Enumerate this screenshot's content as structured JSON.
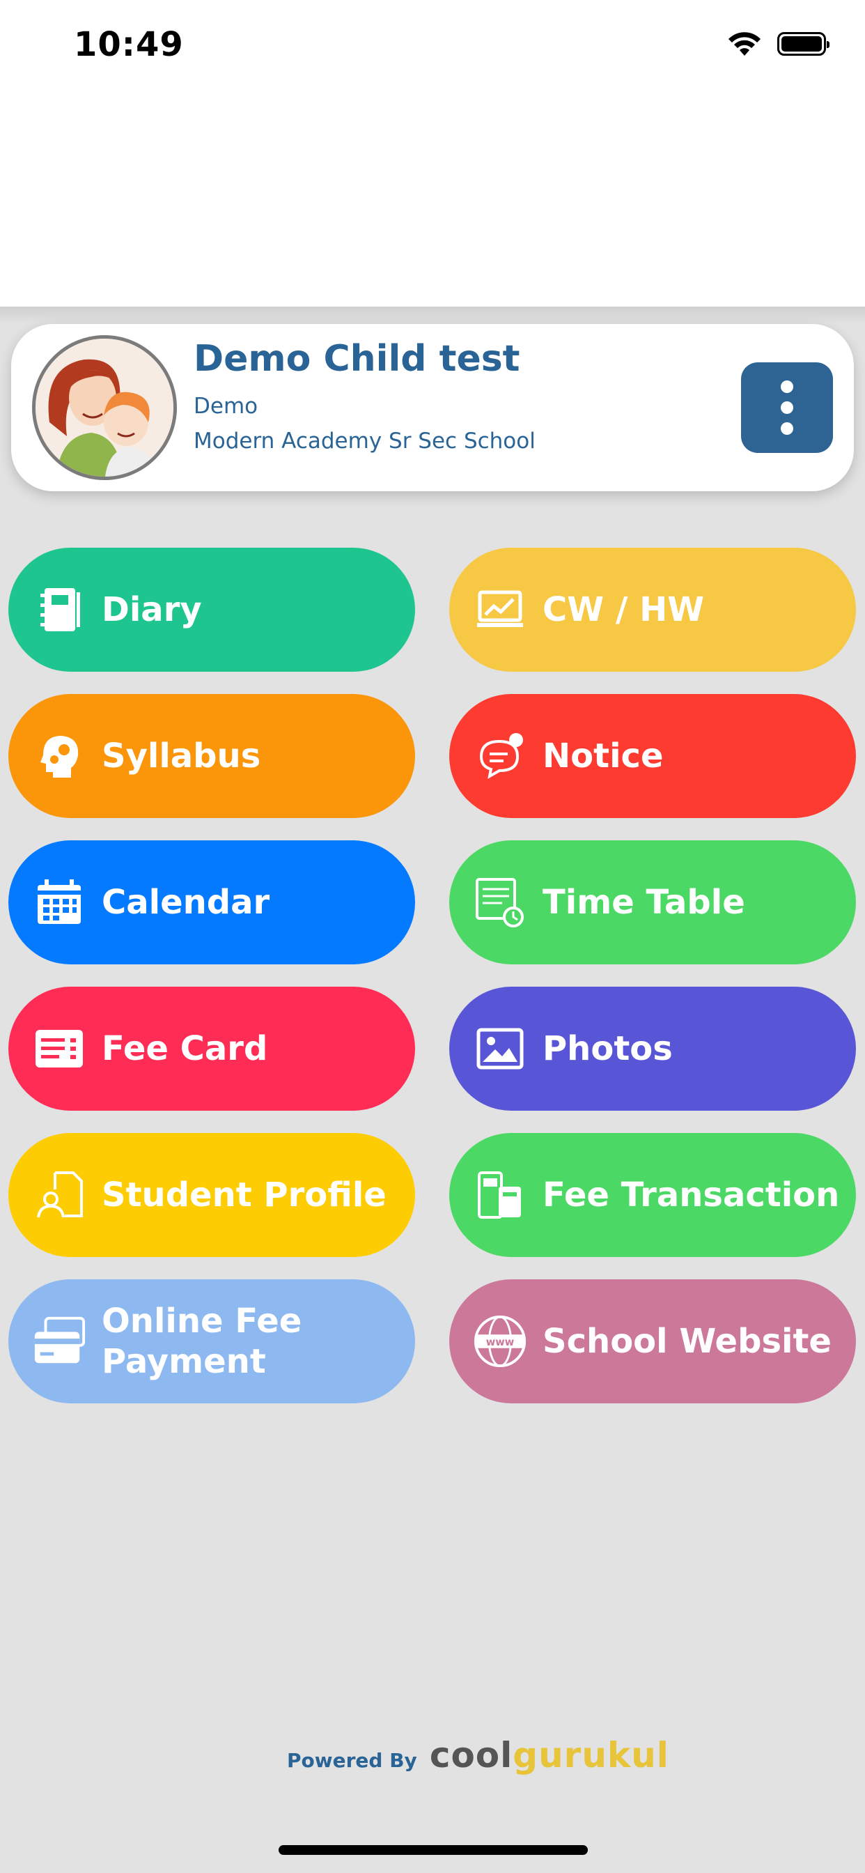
{
  "status_bar": {
    "time": "10:49"
  },
  "profile": {
    "name": "Demo Child test",
    "class": "Demo",
    "school": "Modern Academy Sr Sec School"
  },
  "tiles": [
    {
      "label": "Diary",
      "icon": "diary-icon",
      "color": "#1fc58e"
    },
    {
      "label": "CW / HW",
      "icon": "chart-board-icon",
      "color": "#f7c844"
    },
    {
      "label": "Syllabus",
      "icon": "head-gears-icon",
      "color": "#fb9509"
    },
    {
      "label": "Notice",
      "icon": "chat-notification-icon",
      "color": "#fe3b30"
    },
    {
      "label": "Calendar",
      "icon": "calendar-icon",
      "color": "#037aff"
    },
    {
      "label": "Time Table",
      "icon": "timetable-clock-icon",
      "color": "#4cd864"
    },
    {
      "label": "Fee Card",
      "icon": "fee-card-icon",
      "color": "#ff2d55"
    },
    {
      "label": "Photos",
      "icon": "photo-icon",
      "color": "#5856d6"
    },
    {
      "label": "Student Profile",
      "icon": "student-profile-icon",
      "color": "#fdcc02"
    },
    {
      "label": "Fee Transaction",
      "icon": "fee-transaction-icon",
      "color": "#4cd864"
    },
    {
      "label": "Online Fee\nPayment",
      "icon": "credit-card-icon",
      "color": "#8eb9f0"
    },
    {
      "label": "School Website",
      "icon": "globe-www-icon",
      "color": "#cc7899"
    }
  ],
  "footer": {
    "powered_by": "Powered By",
    "brand_part1": "cool",
    "brand_part2": "gurukul"
  }
}
